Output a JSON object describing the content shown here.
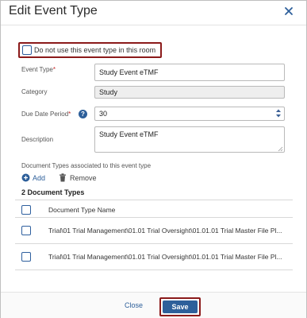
{
  "dialog": {
    "title": "Edit Event Type"
  },
  "options": {
    "do_not_use_label": "Do not use this event type in this room"
  },
  "form": {
    "event_type": {
      "label": "Event Type",
      "required_mark": "*",
      "value": "Study Event eTMF"
    },
    "category": {
      "label": "Category",
      "value": "Study"
    },
    "due_date_period": {
      "label": "Due Date Period",
      "required_mark": "*",
      "value": "30",
      "help_label": "?"
    },
    "description": {
      "label": "Description",
      "value": "Study Event eTMF"
    }
  },
  "doc_types": {
    "section_label": "Document Types associated to this event type",
    "add_label": "Add",
    "remove_label": "Remove",
    "count_label": "2 Document Types",
    "columns": [
      "Document Type Name"
    ],
    "rows": [
      {
        "name": "Trial\\01 Trial Management\\01.01 Trial Oversight\\01.01.01 Trial Master File Pl..."
      },
      {
        "name": "Trial\\01 Trial Management\\01.01 Trial Oversight\\01.01.01 Trial Master File Pl..."
      }
    ]
  },
  "footer": {
    "close_label": "Close",
    "save_label": "Save"
  },
  "colors": {
    "primary": "#2d5f9a",
    "highlight_border": "#8b1a1a",
    "required": "#c62828"
  },
  "icons": {
    "close": "close-icon",
    "add": "plus-circle-icon",
    "remove": "trash-icon",
    "help": "question-circle-icon",
    "spinner_up": "chevron-up-icon",
    "spinner_down": "chevron-down-icon"
  }
}
